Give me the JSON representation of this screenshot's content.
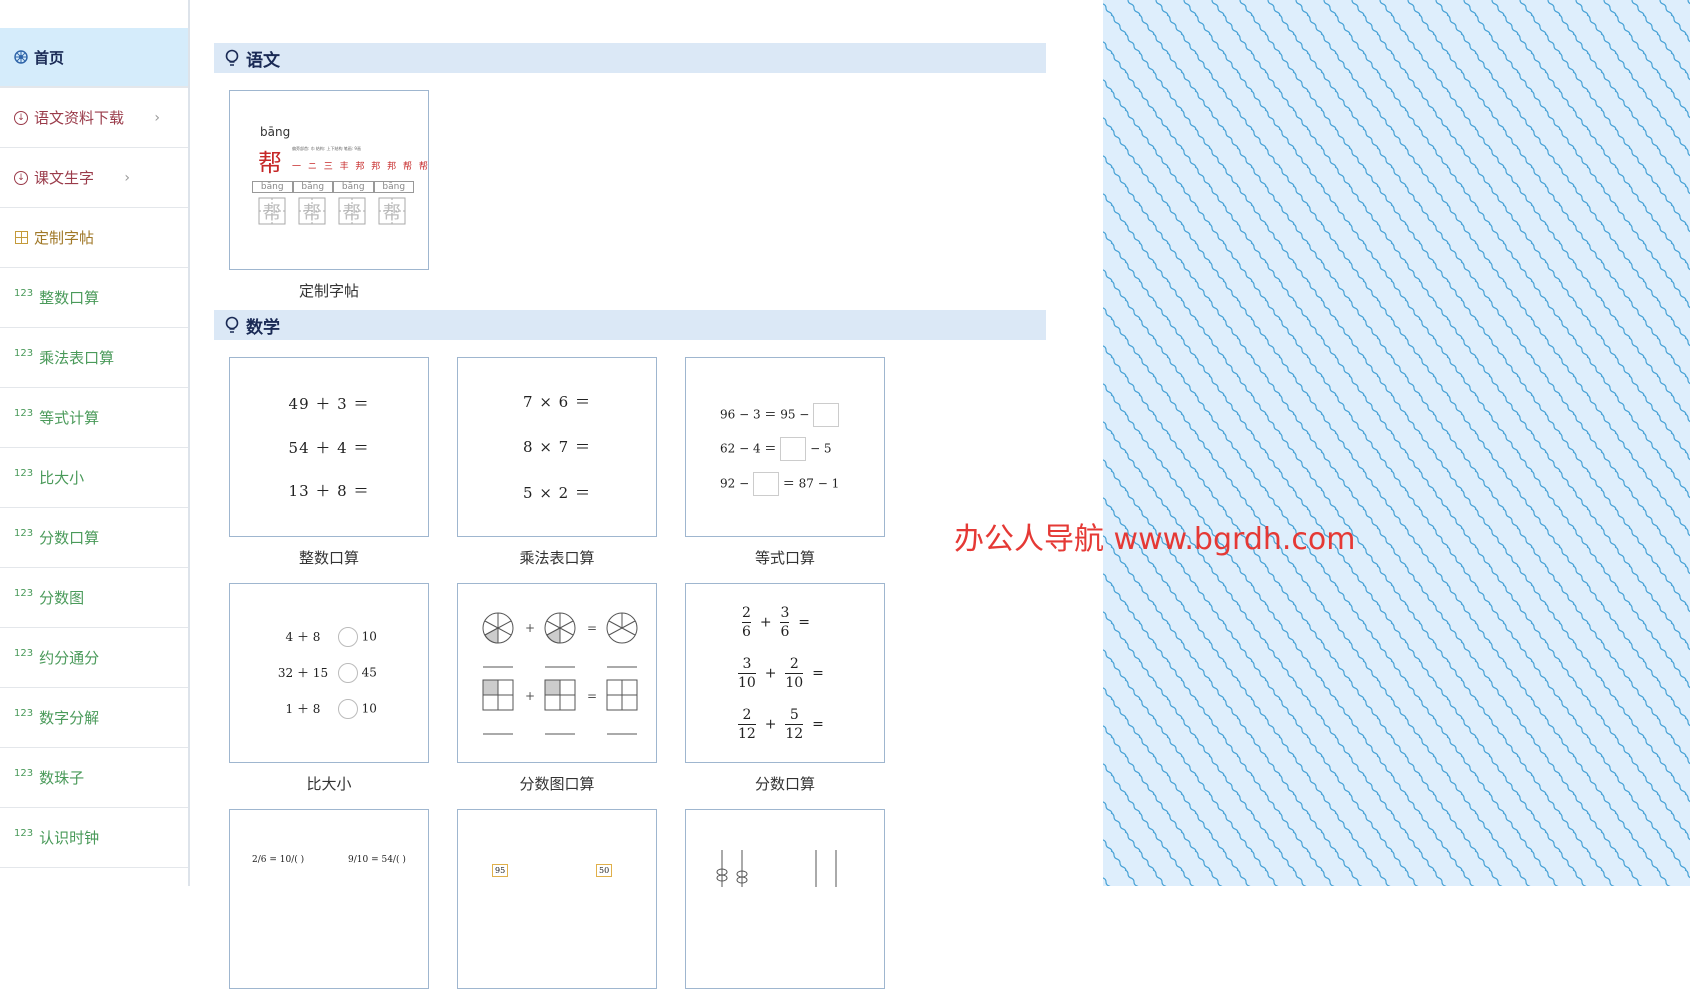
{
  "sidebar": {
    "items": [
      {
        "label": "首页",
        "icon": "wheel-icon",
        "color": "active"
      },
      {
        "label": "语文资料下载",
        "icon": "download-icon",
        "color": "red",
        "chevron": true
      },
      {
        "label": "课文生字",
        "icon": "download-icon",
        "color": "red",
        "chevron": true
      },
      {
        "label": "定制字帖",
        "icon": "grid-icon",
        "color": "gold"
      },
      {
        "label": "整数口算",
        "icon": "123-icon",
        "color": "green"
      },
      {
        "label": "乘法表口算",
        "icon": "123-icon",
        "color": "green"
      },
      {
        "label": "等式计算",
        "icon": "123-icon",
        "color": "green"
      },
      {
        "label": "比大小",
        "icon": "123-icon",
        "color": "green"
      },
      {
        "label": "分数口算",
        "icon": "123-icon",
        "color": "green"
      },
      {
        "label": "分数图",
        "icon": "123-icon",
        "color": "green"
      },
      {
        "label": "约分通分",
        "icon": "123-icon",
        "color": "green"
      },
      {
        "label": "数字分解",
        "icon": "123-icon",
        "color": "green"
      },
      {
        "label": "数珠子",
        "icon": "123-icon",
        "color": "green"
      },
      {
        "label": "认识时钟",
        "icon": "123-icon",
        "color": "green"
      }
    ],
    "num_glyph": "123"
  },
  "sections": {
    "chinese": {
      "title": "语文"
    },
    "math": {
      "title": "数学"
    }
  },
  "cards": {
    "copybook": {
      "caption": "定制字帖",
      "pinyin": "bāng",
      "char": "帮",
      "tiny_meta": "偏旁部首: 巾   结构: 上下结构   笔画: 9画",
      "strokes": "一 ニ 三 丰 邦 邦 邦 帮 帮",
      "cell_pinyin": [
        "bāng",
        "bāng",
        "bāng",
        "bāng"
      ]
    },
    "integer": {
      "caption": "整数口算",
      "lines": [
        "49 ＋ 3 ＝",
        "54 ＋ 4 ＝",
        "13 ＋ 8 ＝"
      ]
    },
    "multiply": {
      "caption": "乘法表口算",
      "lines": [
        "7 × 6 ＝",
        "8 × 7 ＝",
        "5 × 2 ＝"
      ]
    },
    "equation": {
      "caption": "等式口算",
      "rows": [
        {
          "a": "96 − 3 ＝ 95 −",
          "b": ""
        },
        {
          "a": "62 − 4 ＝",
          "b": "− 5"
        },
        {
          "a": "92 −",
          "b": "＝ 87 − 1"
        }
      ]
    },
    "compare": {
      "caption": "比大小",
      "rows": [
        {
          "left": "4 ＋ 8",
          "right": "10"
        },
        {
          "left": "32 ＋ 15",
          "right": "45"
        },
        {
          "left": "1 ＋ 8",
          "right": "10"
        }
      ]
    },
    "fraction_pic": {
      "caption": "分数图口算",
      "plus": "+",
      "eq": "="
    },
    "fraction": {
      "caption": "分数口算",
      "rows": [
        {
          "n1": "2",
          "d1": "6",
          "n2": "3",
          "d2": "6"
        },
        {
          "n1": "3",
          "d1": "10",
          "n2": "2",
          "d2": "10"
        },
        {
          "n1": "2",
          "d1": "12",
          "n2": "5",
          "d2": "12"
        }
      ],
      "plus": "+",
      "eq": "="
    },
    "reduce": {
      "f1": "2/6 = 10/( )",
      "f2": "9/10 = 54/( )"
    },
    "decompose": {
      "n1": "95",
      "n2": "50"
    }
  },
  "watermark": "办公人导航 www.bgrdh.com",
  "colors": {
    "accent": "#d5ecfb",
    "section": "#dbe8f6",
    "pattern": "#deeefc",
    "wave": "#4aa3d6"
  }
}
